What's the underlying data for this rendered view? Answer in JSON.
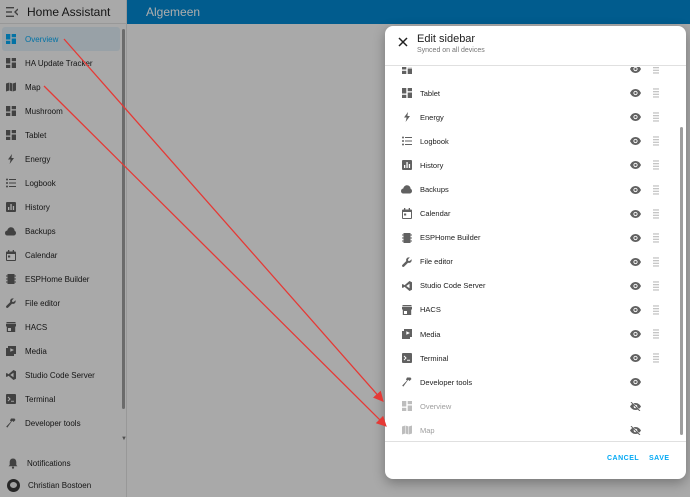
{
  "app": {
    "title": "Home Assistant",
    "view_title": "Algemeen"
  },
  "sidebar": {
    "items": [
      {
        "label": "Overview",
        "icon": "view-dashboard-icon",
        "active": true
      },
      {
        "label": "HA Update Tracker",
        "icon": "view-dashboard-icon"
      },
      {
        "label": "Map",
        "icon": "map-icon"
      },
      {
        "label": "Mushroom",
        "icon": "view-dashboard-icon"
      },
      {
        "label": "Tablet",
        "icon": "view-dashboard-icon"
      },
      {
        "label": "Energy",
        "icon": "lightning-bolt-icon"
      },
      {
        "label": "Logbook",
        "icon": "format-list-bulleted-icon"
      },
      {
        "label": "History",
        "icon": "chart-box-icon"
      },
      {
        "label": "Backups",
        "icon": "cloud-upload-icon"
      },
      {
        "label": "Calendar",
        "icon": "calendar-icon"
      },
      {
        "label": "ESPHome Builder",
        "icon": "chip-icon"
      },
      {
        "label": "File editor",
        "icon": "wrench-icon"
      },
      {
        "label": "HACS",
        "icon": "store-icon"
      },
      {
        "label": "Media",
        "icon": "play-box-icon"
      },
      {
        "label": "Studio Code Server",
        "icon": "vscode-icon"
      },
      {
        "label": "Terminal",
        "icon": "console-icon"
      },
      {
        "label": "Developer tools",
        "icon": "hammer-icon"
      }
    ],
    "notifications_label": "Notifications",
    "user_name": "Christian Bostoen"
  },
  "dialog": {
    "title": "Edit sidebar",
    "subtitle": "Synced on all devices",
    "items": [
      {
        "label": "",
        "icon": "view-dashboard-icon",
        "hidden": false
      },
      {
        "label": "Tablet",
        "icon": "view-dashboard-icon",
        "hidden": false
      },
      {
        "label": "Energy",
        "icon": "lightning-bolt-icon",
        "hidden": false
      },
      {
        "label": "Logbook",
        "icon": "format-list-bulleted-icon",
        "hidden": false
      },
      {
        "label": "History",
        "icon": "chart-box-icon",
        "hidden": false
      },
      {
        "label": "Backups",
        "icon": "cloud-upload-icon",
        "hidden": false
      },
      {
        "label": "Calendar",
        "icon": "calendar-icon",
        "hidden": false
      },
      {
        "label": "ESPHome Builder",
        "icon": "chip-icon",
        "hidden": false
      },
      {
        "label": "File editor",
        "icon": "wrench-icon",
        "hidden": false
      },
      {
        "label": "Studio Code Server",
        "icon": "vscode-icon",
        "hidden": false
      },
      {
        "label": "HACS",
        "icon": "store-icon",
        "hidden": false
      },
      {
        "label": "Media",
        "icon": "play-box-icon",
        "hidden": false
      },
      {
        "label": "Terminal",
        "icon": "console-icon",
        "hidden": false
      },
      {
        "label": "Developer tools",
        "icon": "hammer-icon",
        "hidden": false,
        "no_drag": true
      },
      {
        "label": "Overview",
        "icon": "view-dashboard-icon",
        "hidden": true
      },
      {
        "label": "Map",
        "icon": "map-icon",
        "hidden": true
      }
    ],
    "cancel_label": "CANCEL",
    "save_label": "SAVE"
  },
  "colors": {
    "accent": "#03a9f4",
    "header": "#0288d1",
    "annotation_arrow": "#e53935"
  }
}
